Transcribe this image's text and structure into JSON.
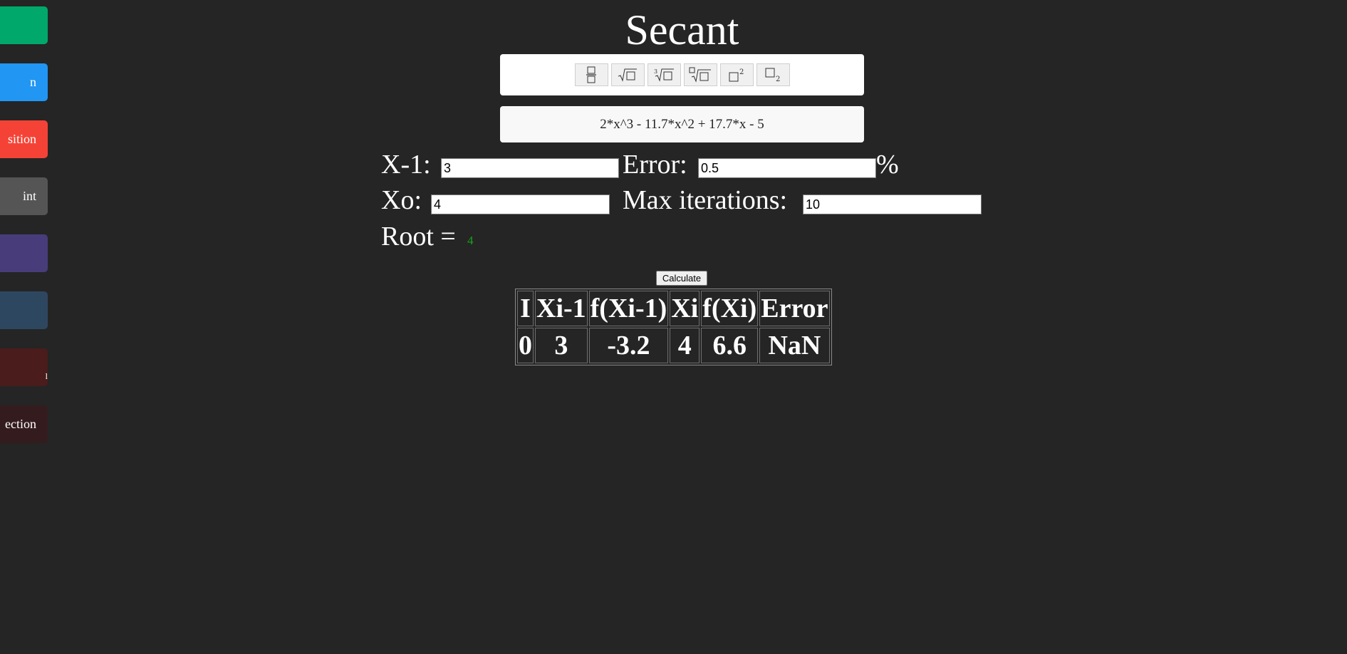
{
  "sidebar": {
    "items": [
      {
        "label": "",
        "color": "#00a86b"
      },
      {
        "label": "n",
        "color": "#2196f3"
      },
      {
        "label": "sition",
        "color": "#f44336"
      },
      {
        "label": "int",
        "color": "#555555"
      },
      {
        "label": "",
        "color": "#483d7a"
      },
      {
        "label": "",
        "color": "#2e4760"
      },
      {
        "label": "l",
        "color": "#4a1c1c"
      },
      {
        "label": "ection",
        "color": "#341c1e"
      }
    ]
  },
  "page": {
    "title": "Secant"
  },
  "toolbar": {
    "buttons": [
      {
        "name": "fraction-icon"
      },
      {
        "name": "sqrt-icon"
      },
      {
        "name": "cube-root-icon"
      },
      {
        "name": "nth-root-icon"
      },
      {
        "name": "superscript-icon"
      },
      {
        "name": "subscript-icon"
      }
    ]
  },
  "function": {
    "expression": "2*x^3 - 11.7*x^2 + 17.7*x - 5"
  },
  "form": {
    "x_prev_label": "X-1:",
    "x_prev_value": "3",
    "error_label": "Error:",
    "error_value": "0.5",
    "percent_sign": "%",
    "x0_label": "Xo:",
    "x0_value": "4",
    "max_iter_label": "Max iterations:",
    "max_iter_value": "10",
    "root_label": "Root =",
    "root_value": "4"
  },
  "actions": {
    "calculate_label": "Calculate"
  },
  "table": {
    "headers": [
      "I",
      "Xi-1",
      "f(Xi-1)",
      "Xi",
      "f(Xi)",
      "Error"
    ],
    "rows": [
      [
        "0",
        "3",
        "-3.2",
        "4",
        "6.6",
        "NaN"
      ]
    ]
  }
}
